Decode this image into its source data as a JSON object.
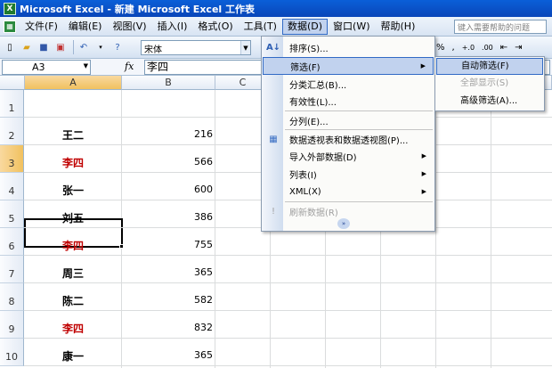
{
  "window": {
    "title": "Microsoft Excel - 新建 Microsoft Excel 工作表"
  },
  "menubar": {
    "items": [
      "文件(F)",
      "编辑(E)",
      "视图(V)",
      "插入(I)",
      "格式(O)",
      "工具(T)",
      "数据(D)",
      "窗口(W)",
      "帮助(H)"
    ],
    "active": "数据(D)",
    "help_placeholder": "键入需要帮助的问题"
  },
  "toolbar": {
    "font_name": "宋体",
    "percent": "%"
  },
  "formula_bar": {
    "cell_ref": "A3",
    "fx": "fx",
    "value": "李四"
  },
  "columns": [
    "A",
    "B",
    "C"
  ],
  "selected_column": "A",
  "rows": [
    {
      "num": "1",
      "name": "",
      "value": "",
      "red": false
    },
    {
      "num": "2",
      "name": "王二",
      "value": "216",
      "red": false
    },
    {
      "num": "3",
      "name": "李四",
      "value": "566",
      "red": true
    },
    {
      "num": "4",
      "name": "张一",
      "value": "600",
      "red": false
    },
    {
      "num": "5",
      "name": "刘五",
      "value": "386",
      "red": false
    },
    {
      "num": "6",
      "name": "李四",
      "value": "755",
      "red": true
    },
    {
      "num": "7",
      "name": "周三",
      "value": "365",
      "red": false
    },
    {
      "num": "8",
      "name": "陈二",
      "value": "582",
      "red": false
    },
    {
      "num": "9",
      "name": "李四",
      "value": "832",
      "red": true
    },
    {
      "num": "10",
      "name": "康一",
      "value": "365",
      "red": false
    }
  ],
  "selected_row": "3",
  "data_menu": {
    "items": [
      {
        "label": "排序(S)...",
        "icon": "sort-icon",
        "submenu": false,
        "disabled": false
      },
      {
        "label": "筛选(F)",
        "icon": "",
        "submenu": true,
        "disabled": false,
        "highlighted": true
      },
      {
        "label": "分类汇总(B)...",
        "icon": "",
        "submenu": false,
        "disabled": false
      },
      {
        "label": "有效性(L)...",
        "icon": "",
        "submenu": false,
        "disabled": false
      },
      {
        "label": "分列(E)...",
        "icon": "",
        "submenu": false,
        "disabled": false
      },
      {
        "label": "数据透视表和数据透视图(P)...",
        "icon": "pivot-table-icon",
        "submenu": false,
        "disabled": false
      },
      {
        "label": "导入外部数据(D)",
        "icon": "",
        "submenu": true,
        "disabled": false
      },
      {
        "label": "列表(I)",
        "icon": "",
        "submenu": true,
        "disabled": false
      },
      {
        "label": "XML(X)",
        "icon": "",
        "submenu": true,
        "disabled": false
      },
      {
        "label": "刷新数据(R)",
        "icon": "refresh-icon",
        "submenu": false,
        "disabled": true
      }
    ]
  },
  "filter_submenu": {
    "items": [
      {
        "label": "自动筛选(F)",
        "highlighted": true,
        "disabled": false
      },
      {
        "label": "全部显示(S)",
        "highlighted": false,
        "disabled": true
      },
      {
        "label": "高级筛选(A)...",
        "highlighted": false,
        "disabled": false
      }
    ]
  },
  "colors": {
    "title_bar": "#0a5fd8",
    "red_text": "#c00000",
    "menu_highlight": "#c1d2ee",
    "highlight_border": "#316ac5"
  }
}
